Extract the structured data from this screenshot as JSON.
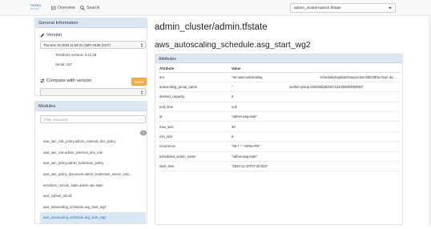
{
  "nav": {
    "brand_line1": "TERRA",
    "brand_line2": "BOARD",
    "overview_label": "Overview",
    "search_label": "Search",
    "state_selected": "admin_cluster/admin.tfstate"
  },
  "general": {
    "heading": "General Information",
    "version_label": "Version",
    "version_selected": "Thu Nov 19 2020 11:53:31 GMT+0100 (CET)",
    "terraform_version": "Terraform version: 0.12.28",
    "serial": "Serial: 157",
    "compare_label": "Compare with version",
    "reset_label": "Reset"
  },
  "modules": {
    "heading": "Modules",
    "filter_placeholder": "Filter resources...",
    "filter_clear": "×",
    "count": "40",
    "items": [
      "aws_iam_role_policy.admin_external_dns_policy",
      "aws_iam_role.admin_external_dns_role",
      "aws_iam_policy.admin_kube2iam_policy",
      "aws_iam_policy_document.admin_kube2iam_server_inlin...",
      "terraform_remote_state.admin-vpc-state",
      "aws_subnet_ids.all",
      "aws_autoscaling_schedule.asg_start_wg4",
      "aws_autoscaling_schedule.asg_start_wg2"
    ],
    "active_index": 7
  },
  "main": {
    "state_title": "admin_cluster/admin.tfstate",
    "resource_title": "aws_autoscaling_schedule.asg_start_wg2",
    "attributes_heading": "Attributes",
    "col_attribute": "Attribute",
    "col_value": "Value",
    "rows": [
      {
        "attr": "arn",
        "value": "\"arn:aws:autoscaling",
        "value2": "scheduledUpdateGroupAction:bb033f0a-31ac-4a..."
      },
      {
        "attr": "autoscaling_group_name",
        "value": "\"",
        "value2": "worker-group-2202006282047124436000000004\""
      },
      {
        "attr": "desired_capacity",
        "value": "8",
        "value2": ""
      },
      {
        "attr": "end_time",
        "value": "null",
        "value2": ""
      },
      {
        "attr": "id",
        "value": "\"admin-asg-start\"",
        "value2": ""
      },
      {
        "attr": "max_size",
        "value": "30",
        "value2": ""
      },
      {
        "attr": "min_size",
        "value": "8",
        "value2": ""
      },
      {
        "attr": "recurrence",
        "value": "\"30 7 * * MON-FRI\"",
        "value2": ""
      },
      {
        "attr": "scheduled_action_name",
        "value": "\"admin-asg-start\"",
        "value2": ""
      },
      {
        "attr": "start_time",
        "value": "\"2020-11-20T07:30:00Z\"",
        "value2": ""
      }
    ]
  }
}
